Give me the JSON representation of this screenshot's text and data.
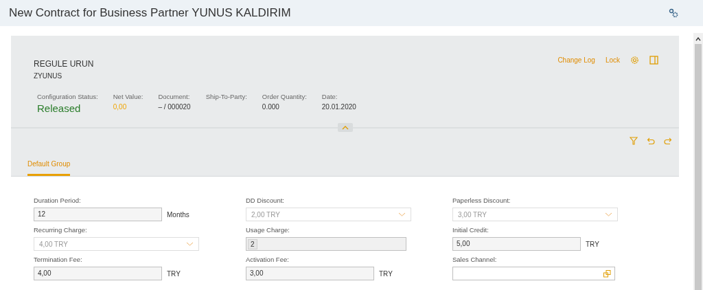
{
  "window": {
    "title": "New Contract for Business Partner YUNUS KALDIRIM"
  },
  "header": {
    "title": "REGULE URUN",
    "subtitle": "ZYUNUS",
    "actions": [
      "Change Log",
      "Lock"
    ],
    "attributes": [
      {
        "label": "Configuration Status:",
        "value": "Released",
        "kind": "status"
      },
      {
        "label": "Net Value:",
        "value": "0,00",
        "kind": "link"
      },
      {
        "label": "Document:",
        "value": "– / 000020",
        "kind": "text"
      },
      {
        "label": "Ship-To-Party:"
      },
      {
        "label": "Order Quantity:",
        "value": "0.000",
        "kind": "text"
      },
      {
        "label": "Date:",
        "value": "20.01.2020",
        "kind": "text"
      }
    ]
  },
  "tabs": [
    {
      "label": "Default Group",
      "selected": true
    }
  ],
  "fields": [
    {
      "label": "Duration Period:",
      "kind": "input",
      "value": "12",
      "unit": "Months"
    },
    {
      "label": "DD Discount:",
      "kind": "select",
      "value": "2,00 TRY",
      "disabled": true
    },
    {
      "label": "Paperless Discount:",
      "kind": "select",
      "value": "3,00 TRY",
      "disabled": true
    },
    {
      "label": "Recurring Charge:",
      "kind": "select",
      "value": "4,00 TRY",
      "disabled": true
    },
    {
      "label": "Usage Charge:",
      "kind": "token",
      "tokens": [
        "2"
      ]
    },
    {
      "label": "Initial Credit:",
      "kind": "input",
      "value": "5,00",
      "unit": "TRY"
    },
    {
      "label": "Termination Fee:",
      "kind": "input",
      "value": "4,00",
      "unit": "TRY"
    },
    {
      "label": "Activation Fee:",
      "kind": "input",
      "value": "3,00",
      "unit": "TRY"
    },
    {
      "label": "Sales Channel:",
      "kind": "valuehelp"
    }
  ]
}
